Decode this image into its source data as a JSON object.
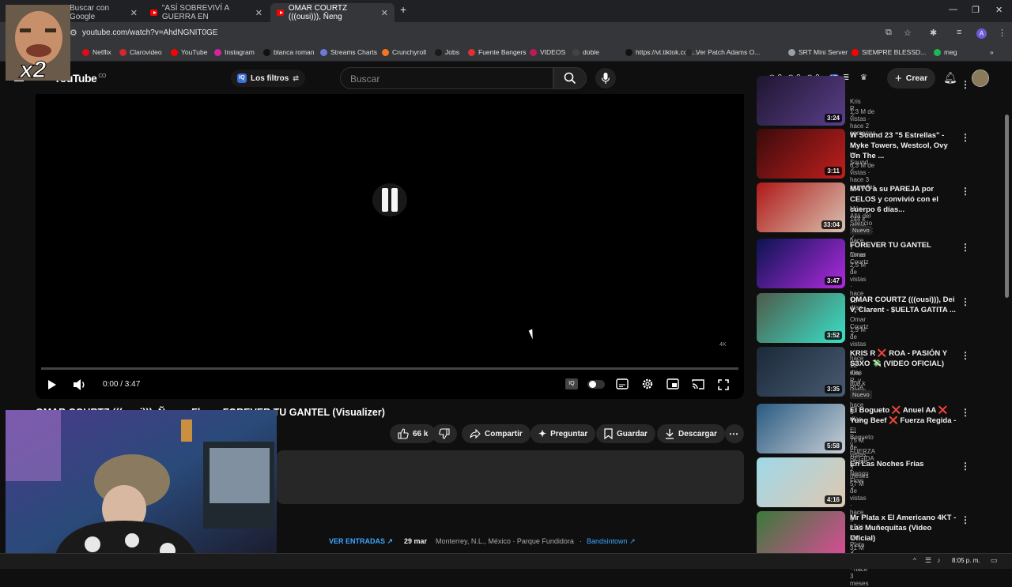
{
  "browser": {
    "tabs": [
      {
        "label": "Buscar con Google",
        "active": false
      },
      {
        "label": "\"ASÍ SOBREVIVÍ A GUERRA EN",
        "active": false
      },
      {
        "label": "OMAR COURTZ (((ousi))), Ñeng",
        "active": true
      }
    ],
    "new_tab": "+",
    "url": "youtube.com/watch?v=AhdNGNIT0GE",
    "bookmarks": [
      {
        "label": "Netflix",
        "color": "#e50914"
      },
      {
        "label": "Clarovideo",
        "color": "#d9262a"
      },
      {
        "label": "YouTube",
        "color": "#ff0000"
      },
      {
        "label": "Instagram",
        "color": "#d6249f"
      },
      {
        "label": "blanca roman",
        "color": "#111111"
      },
      {
        "label": "Streams Charts",
        "color": "#6c7bd8"
      },
      {
        "label": "Crunchyroll",
        "color": "#f47521"
      },
      {
        "label": "Jobs",
        "color": "#1a1a1a"
      },
      {
        "label": "Fuente Bangers",
        "color": "#e03030"
      },
      {
        "label": "VIDEOS",
        "color": "#c2185b"
      },
      {
        "label": "doble",
        "color": "#444444"
      },
      {
        "label": "https://vt.tiktok.com...",
        "color": "#111111"
      },
      {
        "label": "Ver Patch Adams O...",
        "color": "#2a2a2a"
      },
      {
        "label": "SRT Mini Server",
        "color": "#9aa0a6"
      },
      {
        "label": "SIEMPRE BLESSD...",
        "color": "#ff0000"
      },
      {
        "label": "meg",
        "color": "#1db954"
      }
    ]
  },
  "youtube": {
    "logo": "YouTube",
    "logo_country": "CO",
    "filters_label": "Los filtros",
    "search_placeholder": "Buscar",
    "counters": [
      "0",
      "0",
      "0"
    ],
    "create_label": "Crear"
  },
  "player": {
    "time": "0:00 / 3:47",
    "watermark": "4K"
  },
  "video": {
    "title": "OMAR COURTZ (((ousi))), Ñengo Flow - FOREVER TU GANTEL (Visualizer)",
    "likes": "66 k",
    "share": "Compartir",
    "ask": "Preguntar",
    "save": "Guardar",
    "download": "Descargar",
    "event_link": "VER ENTRADAS",
    "event_date": "29 mar",
    "event_place": "Monterrey, N.L., México · Parque Fundidora",
    "event_sep": "·",
    "event_source": "Bandsintown"
  },
  "recommendations": [
    {
      "title": "",
      "channel": "Kris R.",
      "meta": "1.3 M de vistas · hace 2 semanas",
      "duration": "3:24",
      "new": false,
      "colors": [
        "#1f1530",
        "#5a3f8a"
      ]
    },
    {
      "title": "W Sound 23 \"5 Estrellas\" - Myke Towers, Westcol, Ovy On The ...",
      "channel": "W Sound",
      "meta": "6.3 M de vistas · hace 3 semanas",
      "duration": "3:11",
      "new": false,
      "colors": [
        "#3a0a0a",
        "#c21f1f"
      ]
    },
    {
      "title": "M4TÓ a su PAREJA por CELOS y convivió con el cuerpo 6 días...",
      "channel": "Más Allá del Silencio Podcast",
      "meta": "144 k vistas · hace 7 horas",
      "duration": "33:04",
      "new": true,
      "colors": [
        "#b01818",
        "#d8c2b0"
      ]
    },
    {
      "title": "FOREVER TU GANTEL",
      "channel": "Omar Courtz",
      "meta": "2.5 M de vistas · hace 12 días",
      "duration": "3:47",
      "new": false,
      "colors": [
        "#0a1450",
        "#b02ae0"
      ]
    },
    {
      "title": "OMAR COURTZ (((ousi))), Dei V, Clarent - $UELTA GATITA ...",
      "channel": "Omar Courtz",
      "meta": "1.9 M de vistas · hace 12 días",
      "duration": "3:52",
      "new": false,
      "colors": [
        "#4e5a4a",
        "#3ae0c8"
      ]
    },
    {
      "title": "KRIS R ❌ ROA - PASIÓN Y S3XO 💸 (VIDEO OFICIAL)",
      "channel": "Kris R. y ROA",
      "meta": "808 k vistas · hace 5 días",
      "duration": "3:35",
      "new": true,
      "colors": [
        "#1a2a3a",
        "#4a5a70"
      ]
    },
    {
      "title": "El Bogueto ❌ Anuel AA ❌ Yung Beef ❌ Fuerza Regida - ...",
      "channel": "El Bogueto y FUERZA REGIDA",
      "meta": "75 M de vistas · hace 2 meses",
      "duration": "5:58",
      "new": false,
      "colors": [
        "#2a5a80",
        "#c8d0d8"
      ]
    },
    {
      "title": "En Las Noches Frias",
      "channel": "Nengo Flow",
      "meta": "57 M de vistas · hace 5 años",
      "duration": "4:16",
      "new": false,
      "colors": [
        "#9ed8e8",
        "#e0c8b0"
      ]
    },
    {
      "title": "Mr Plata x El Americano 4KT - Las Muñequitas (Video Oficial)",
      "channel": "Mr Plata",
      "meta": "31 M de vistas · hace 3 meses",
      "duration": "",
      "new": false,
      "colors": [
        "#3a7a3a",
        "#e04a9a"
      ]
    }
  ],
  "overlays": {
    "meme_text": "x2"
  },
  "taskbar": {
    "time": "8:05 p. m."
  }
}
